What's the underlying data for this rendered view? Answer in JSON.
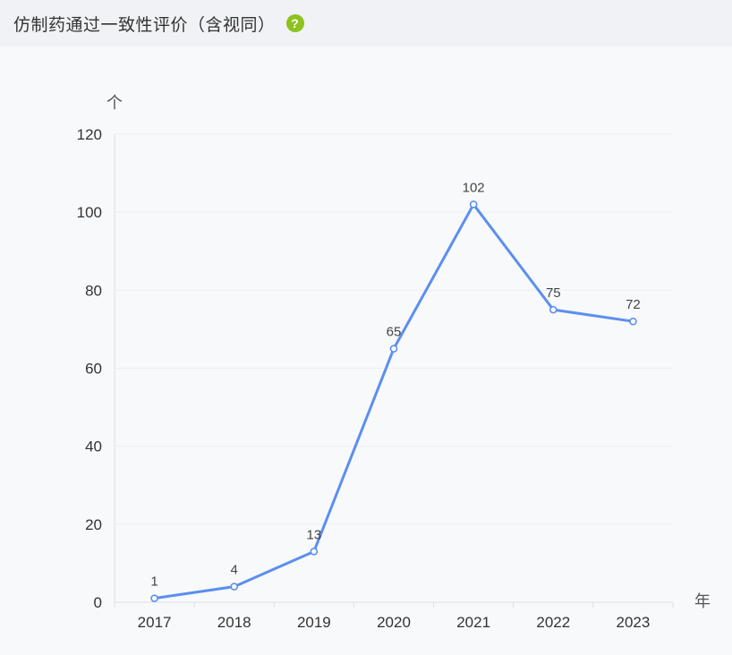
{
  "header": {
    "title": "仿制药通过一致性评价（含视同）",
    "help_icon": "question-circle-icon",
    "help_icon_glyph": "?",
    "help_icon_color": "#8dc21f"
  },
  "chart_data": {
    "type": "line",
    "categories": [
      "2017",
      "2018",
      "2019",
      "2020",
      "2021",
      "2022",
      "2023"
    ],
    "values": [
      1,
      4,
      13,
      65,
      102,
      75,
      72
    ],
    "ylabel": "个",
    "xlabel": "年",
    "ylim": [
      0,
      120
    ],
    "yticks": [
      0,
      20,
      40,
      60,
      80,
      100,
      120
    ],
    "line_color": "#5b8ff0",
    "grid": true,
    "data_labels": true
  }
}
